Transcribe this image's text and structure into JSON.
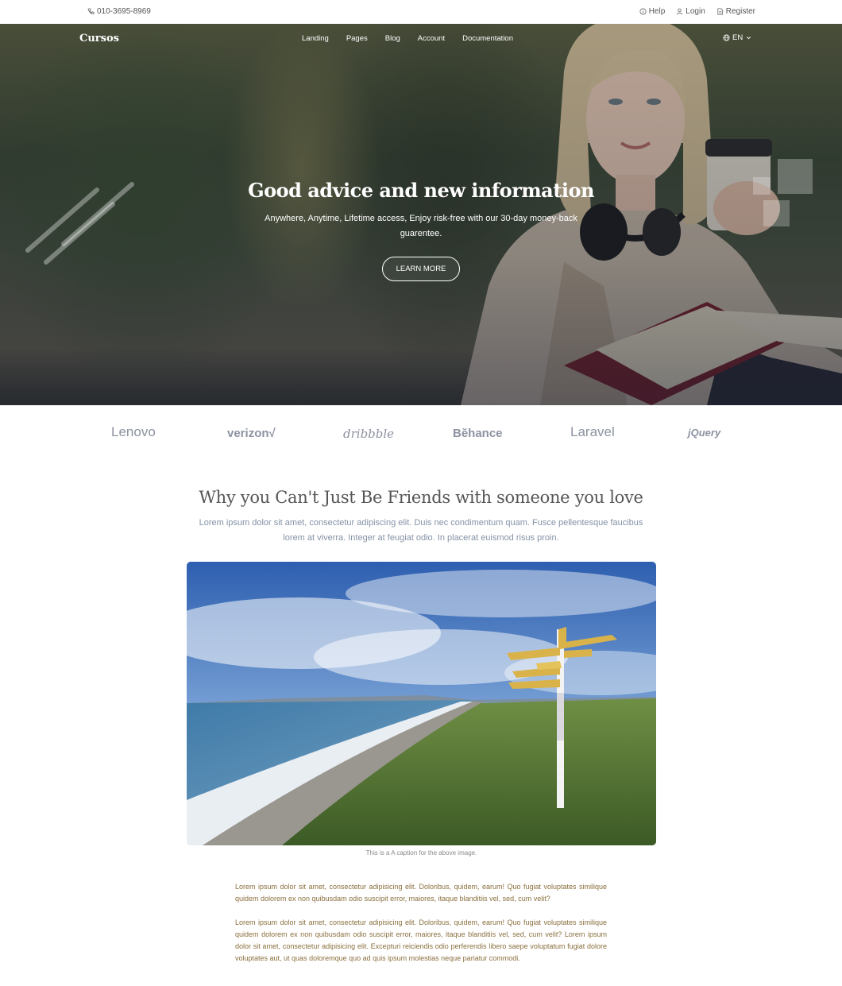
{
  "topbar": {
    "phone": "010-3695-8969",
    "help": "Help",
    "login": "Login",
    "register": "Register"
  },
  "nav": {
    "brand": "Cursos",
    "items": [
      {
        "label": "Landing"
      },
      {
        "label": "Pages"
      },
      {
        "label": "Blog"
      },
      {
        "label": "Account"
      },
      {
        "label": "Documentation"
      }
    ],
    "language": "EN"
  },
  "hero": {
    "title": "Good advice and new information",
    "subtitle": "Anywhere, Anytime, Lifetime access, Enjoy risk-free with our 30-day money-back guarentee.",
    "button": "LEARN MORE"
  },
  "logos": [
    "Lenovo",
    "verizon√",
    "dribbble",
    "Bĕhance",
    "Laravel",
    "jQuery"
  ],
  "section": {
    "title": "Why you Can't Just Be Friends with someone you love",
    "subtitle": "Lorem ipsum dolor sit amet, consectetur adipiscing elit. Duis nec condimentum quam. Fusce pellentesque faucibus lorem at viverra. Integer at feugiat odio. In placerat euismod risus proin.",
    "caption": "This is a A caption for the above image.",
    "paragraphs": [
      "Lorem ipsum dolor sit amet, consectetur adipisicing elit. Doloribus, quidem, earum! Quo fugiat voluptates similique quidem dolorem ex non quibusdam odio suscipit error, maiores, itaque blanditiis vel, sed, cum velit?",
      "Lorem ipsum dolor sit amet, consectetur adipisicing elit. Doloribus, quidem, earum! Quo fugiat voluptates similique quidem dolorem ex non quibusdam odio suscipit error, maiores, itaque blanditiis vel, sed, cum velit? Lorem ipsum dolor sit amet, consectetur adipisicing elit. Excepturi reiciendis odio perferendis libero saepe voluptatum fugiat dolore voluptates aut, ut quas doloremque quo ad quis ipsum molestias neque pariatur commodi."
    ]
  },
  "colors": {
    "text_muted": "#8492a6",
    "heading": "#555555",
    "paragraph": "#8a6f3d",
    "logo_gray": "#8c92a0"
  }
}
